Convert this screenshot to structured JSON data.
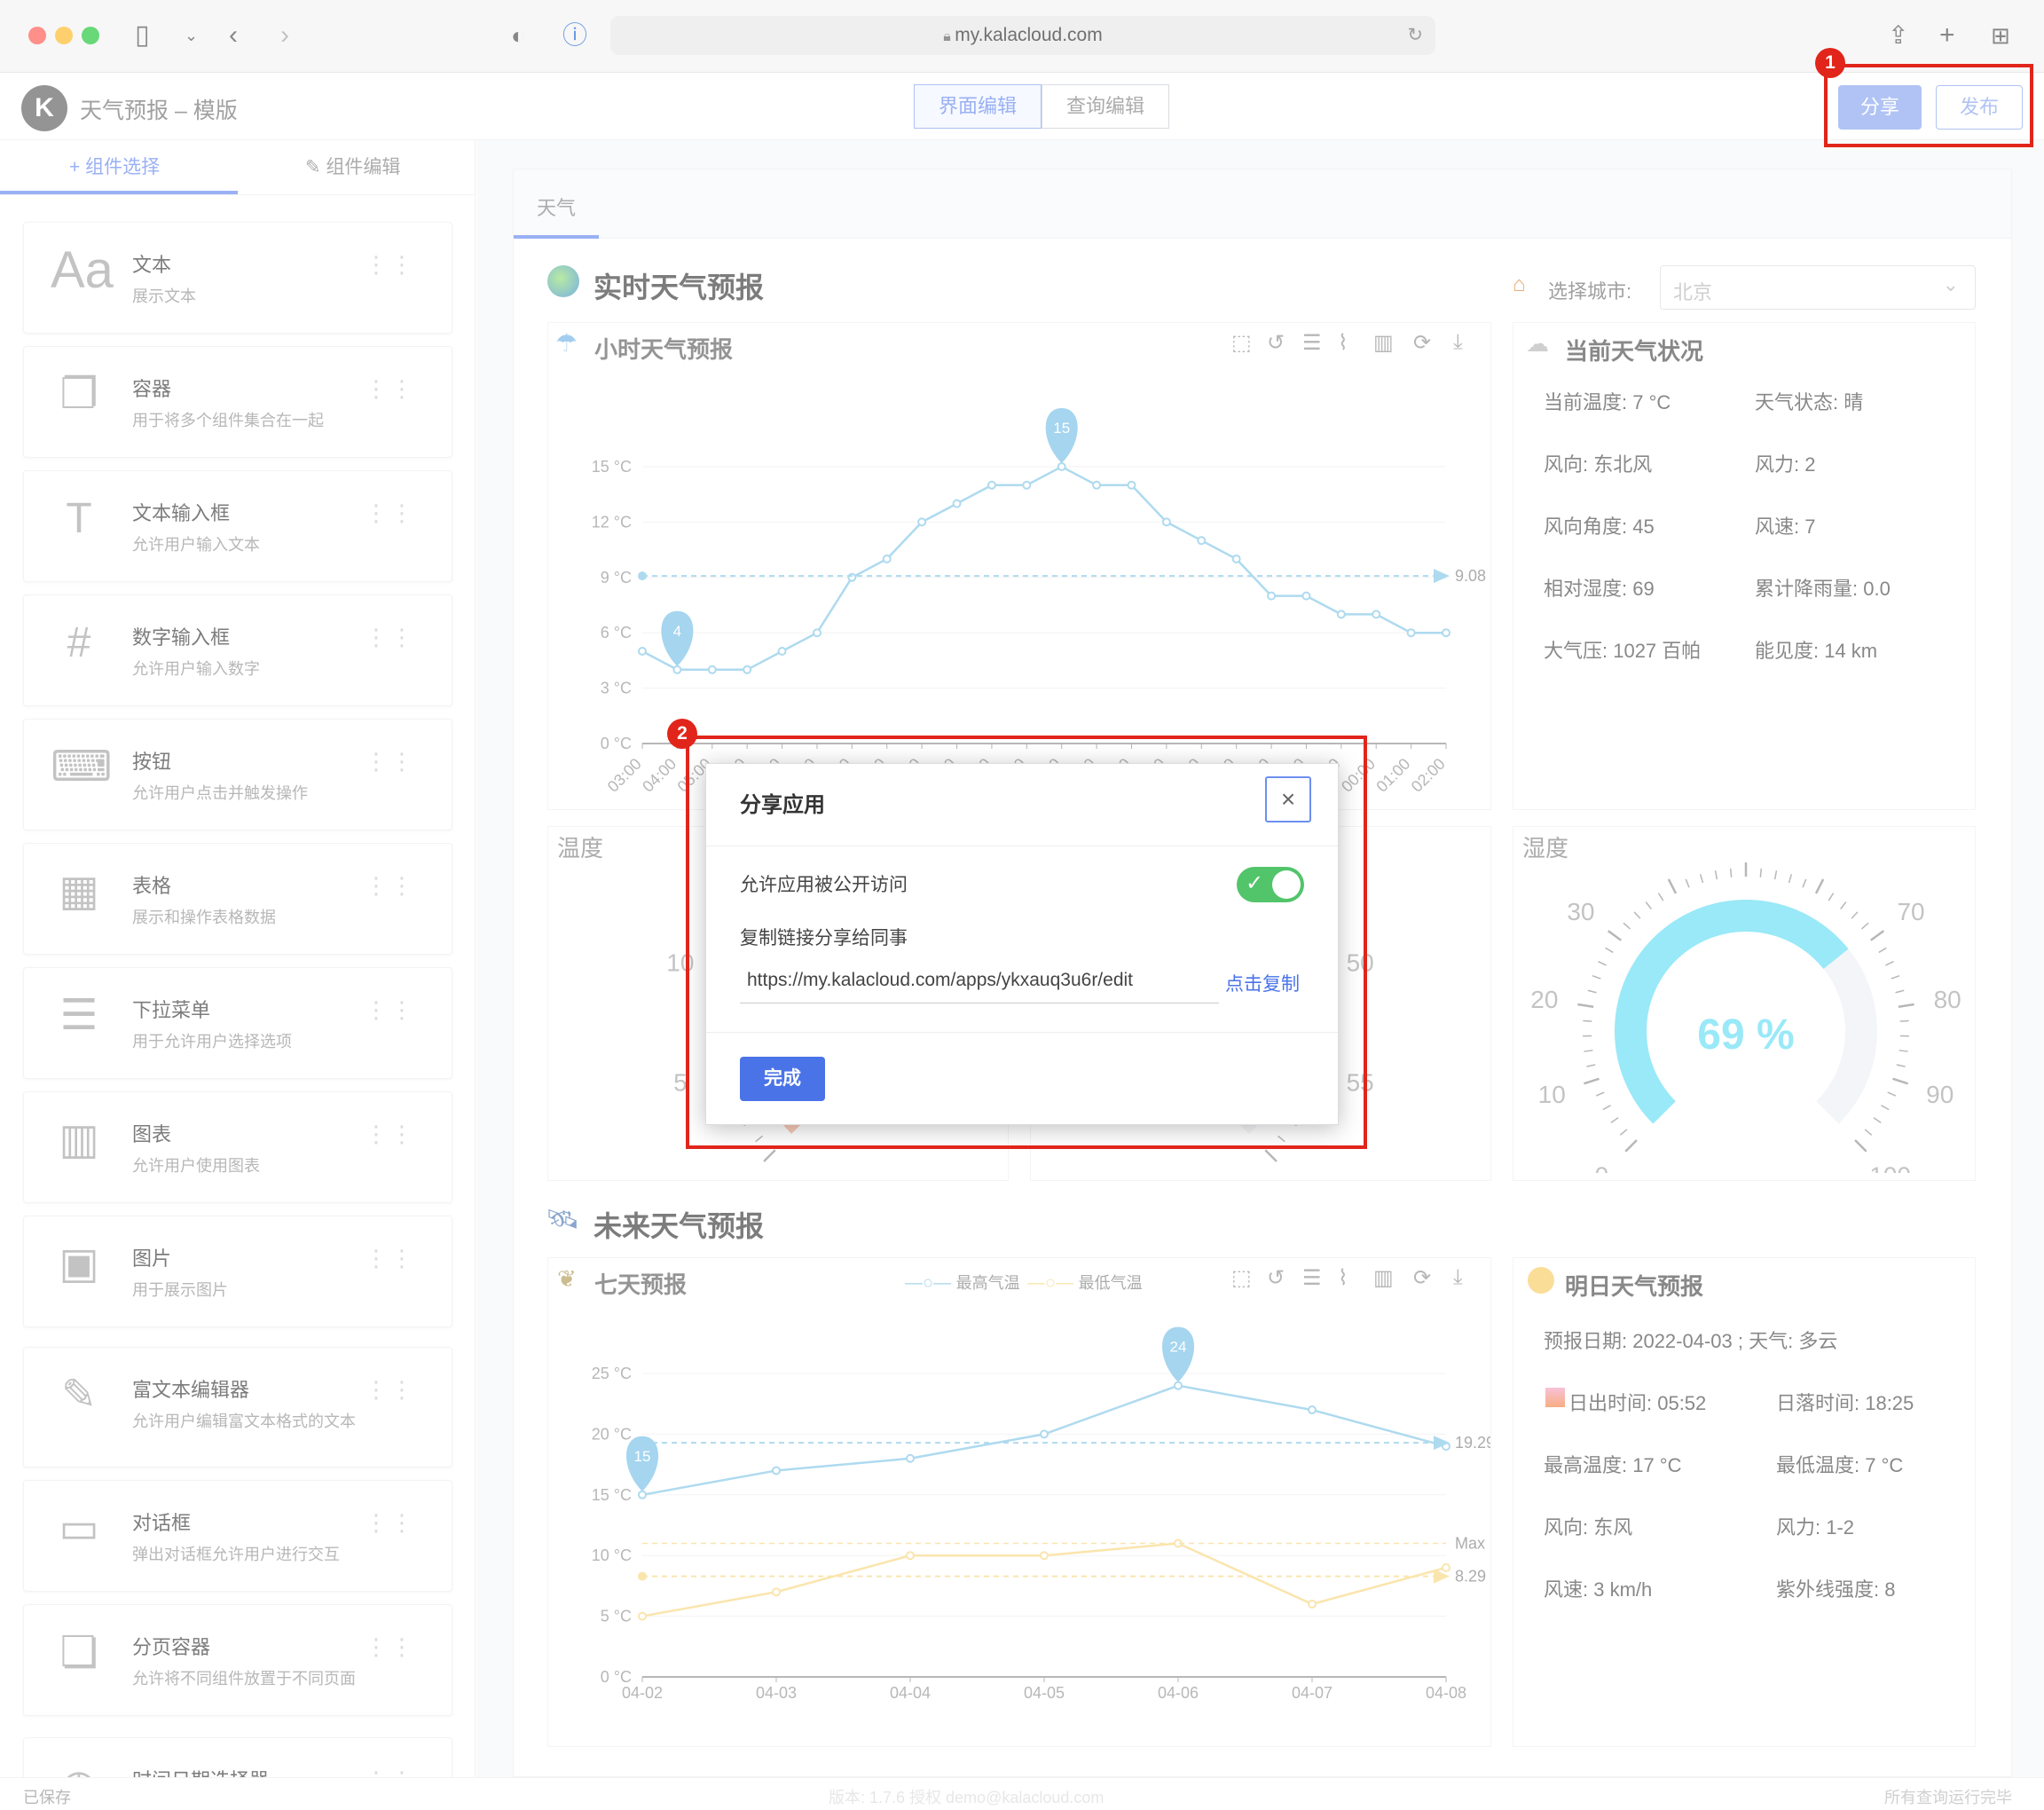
{
  "browser": {
    "url": "my.kalacloud.com"
  },
  "app": {
    "title": "天气预报 – 模版",
    "mode_tabs": [
      "界面编辑",
      "查询编辑"
    ],
    "share_label": "分享",
    "publish_label": "发布"
  },
  "sidebar": {
    "tab_select": "+ 组件选择",
    "tab_edit": "组件编辑",
    "components": [
      {
        "title": "文本",
        "desc": "展示文本",
        "icon": "text-icon"
      },
      {
        "title": "容器",
        "desc": "用于将多个组件集合在一起",
        "icon": "container-icon"
      },
      {
        "title": "文本输入框",
        "desc": "允许用户输入文本",
        "icon": "text-input-icon"
      },
      {
        "title": "数字输入框",
        "desc": "允许用户输入数字",
        "icon": "number-input-icon"
      },
      {
        "title": "按钮",
        "desc": "允许用户点击并触发操作",
        "icon": "button-icon"
      },
      {
        "title": "表格",
        "desc": "展示和操作表格数据",
        "icon": "table-icon"
      },
      {
        "title": "下拉菜单",
        "desc": "用于允许用户选择选项",
        "icon": "dropdown-icon"
      },
      {
        "title": "图表",
        "desc": "允许用户使用图表",
        "icon": "chart-icon"
      },
      {
        "title": "图片",
        "desc": "用于展示图片",
        "icon": "image-icon"
      },
      {
        "title": "富文本编辑器",
        "desc": "允许用户编辑富文本格式的文本",
        "icon": "rich-text-icon"
      },
      {
        "title": "对话框",
        "desc": "弹出对话框允许用户进行交互",
        "icon": "dialog-icon"
      },
      {
        "title": "分页容器",
        "desc": "允许将不同组件放置于不同页面",
        "icon": "tabs-container-icon"
      },
      {
        "title": "时间日期选择器",
        "desc": "",
        "icon": "datetime-icon"
      }
    ]
  },
  "page": {
    "tab": "天气",
    "realtime_title": "实时天气预报",
    "city_label": "选择城市:",
    "city_value": "北京",
    "hourly_title": "小时天气预报",
    "current_title": "当前天气状况",
    "current": [
      [
        "当前温度: 7 °C",
        "天气状态: 晴"
      ],
      [
        "风向: 东北风",
        "风力: 2"
      ],
      [
        "风向角度: 45",
        "风速: 7"
      ],
      [
        "相对湿度: 69",
        "累计降雨量: 0.0"
      ],
      [
        "大气压: 1027 百帕",
        "能见度: 14 km"
      ]
    ],
    "temp_gauge_title": "温度",
    "humidity_gauge_title": "湿度",
    "humidity_value": "69 %",
    "future_title": "未来天气预报",
    "seven_day_title": "七天预报",
    "legend_high": "最高气温",
    "legend_low": "最低气温",
    "tomorrow_title": "明日天气预报",
    "tomorrow": [
      [
        "预报日期: 2022-04-03 ; 天气: 多云",
        ""
      ],
      [
        "日出时间: 05:52",
        "日落时间: 18:25"
      ],
      [
        "最高温度: 17 °C",
        "最低温度: 7 °C"
      ],
      [
        "风向: 东风",
        "风力: 1-2"
      ],
      [
        "风速: 3 km/h",
        "紫外线强度: 8"
      ]
    ]
  },
  "dialog": {
    "title": "分享应用",
    "public_label": "允许应用被公开访问",
    "public_enabled": true,
    "copy_label": "复制链接分享给同事",
    "link": "https://my.kalacloud.com/apps/ykxauq3u6r/edit",
    "copy_button": "点击复制",
    "done_button": "完成"
  },
  "status": {
    "left": "已保存",
    "center": "版本: 1.7.6 授权 demo@kalacloud.com",
    "right": "所有查询运行完毕"
  },
  "annotations": {
    "badge1": "1",
    "badge2": "2"
  },
  "colors": {
    "accent": "#5b7ee6",
    "chart_line": "#8ccbe8",
    "chart_low": "#f8da8a",
    "annotation": "#e1251b",
    "toggle_on": "#52c46a",
    "humidity_gauge": "#6ee0f5"
  },
  "chart_data": [
    {
      "type": "line",
      "title": "小时天气预报",
      "x": [
        "03:00",
        "04:00",
        "05:00",
        "06:00",
        "07:00",
        "08:00",
        "09:00",
        "10:00",
        "11:00",
        "12:00",
        "13:00",
        "14:00",
        "15:00",
        "16:00",
        "17:00",
        "18:00",
        "19:00",
        "20:00",
        "21:00",
        "22:00",
        "23:00",
        "00:00",
        "01:00",
        "02:00"
      ],
      "series": [
        {
          "values": [
            5,
            4,
            4,
            4,
            5,
            6,
            9,
            10,
            12,
            13,
            14,
            14,
            15,
            14,
            14,
            12,
            11,
            10,
            8,
            8,
            7,
            7,
            6,
            6
          ]
        }
      ],
      "yticks": [
        "0 °C",
        "3 °C",
        "6 °C",
        "9 °C",
        "12 °C",
        "15 °C"
      ],
      "ylim": [
        0,
        15
      ],
      "mark_max": 15,
      "mark_min": 4,
      "average": 9.08
    },
    {
      "type": "line",
      "title": "七天预报",
      "x": [
        "04-02",
        "04-03",
        "04-04",
        "04-05",
        "04-06",
        "04-07",
        "04-08"
      ],
      "series": [
        {
          "name": "最高气温",
          "values": [
            15,
            17,
            18,
            20,
            24,
            22,
            19
          ]
        },
        {
          "name": "最低气温",
          "values": [
            5,
            7,
            10,
            10,
            11,
            6,
            9
          ]
        }
      ],
      "yticks": [
        "0 °C",
        "5 °C",
        "10 °C",
        "15 °C",
        "20 °C",
        "25 °C"
      ],
      "ylim": [
        0,
        25
      ],
      "mark_max": 24,
      "mark_min": 15,
      "average_high": 19.29,
      "average_low": 8.29,
      "max_label": "Max"
    }
  ]
}
